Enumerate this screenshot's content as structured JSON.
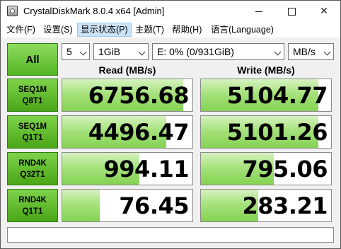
{
  "window": {
    "title": "CrystalDiskMark 8.0.4 x64 [Admin]"
  },
  "menu": {
    "items": [
      {
        "label": "文件(F)",
        "active": false
      },
      {
        "label": "设置(S)",
        "active": false
      },
      {
        "label": "显示状态(P)",
        "active": true
      },
      {
        "label": "主题(T)",
        "active": false
      },
      {
        "label": "帮助(H)",
        "active": false
      },
      {
        "label": "语言(Language)",
        "active": false
      }
    ]
  },
  "controls": {
    "all_label": "All",
    "count": "5",
    "size": "1GiB",
    "drive": "E: 0% (0/931GiB)",
    "unit": "MB/s"
  },
  "headers": {
    "read": "Read (MB/s)",
    "write": "Write (MB/s)"
  },
  "tests": [
    {
      "line1": "SEQ1M",
      "line2": "Q8T1",
      "read": "6756.68",
      "write": "5104.77",
      "read_fill": 0.93,
      "write_fill": 0.9
    },
    {
      "line1": "SEQ1M",
      "line2": "Q1T1",
      "read": "4496.47",
      "write": "5101.26",
      "read_fill": 0.8,
      "write_fill": 0.9
    },
    {
      "line1": "RND4K",
      "line2": "Q32T1",
      "read": "994.11",
      "write": "795.06",
      "read_fill": 0.59,
      "write_fill": 0.56
    },
    {
      "line1": "RND4K",
      "line2": "Q1T1",
      "read": "76.45",
      "write": "283.21",
      "read_fill": 0.29,
      "write_fill": 0.44
    }
  ],
  "status": {
    "text": ""
  },
  "colors": {
    "accent_green": "#54b521",
    "bar_green": "#a7e27d",
    "menu_highlight": "#cce4f7"
  }
}
